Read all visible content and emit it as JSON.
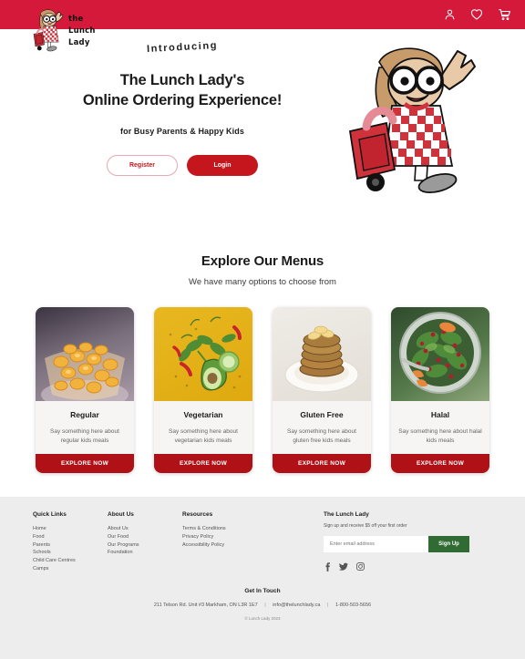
{
  "header": {
    "logo": {
      "mark": "lunch-lady-mascot-logo",
      "line1": "the",
      "line2": "Lunch",
      "line3": "Lady"
    },
    "icons": [
      {
        "name": "account-icon",
        "label": "Account"
      },
      {
        "name": "wishlist-heart-icon",
        "label": "Wishlist"
      },
      {
        "name": "shopping-cart-icon",
        "label": "Cart"
      }
    ],
    "background_color": "#D4193A"
  },
  "hero": {
    "eyebrow": "Introducing",
    "title_line1": "The Lunch Lady's",
    "title_line2": "Online Ordering Experience!",
    "subtitle": "for Busy Parents & Happy Kids",
    "register_label": "Register",
    "login_label": "Login",
    "register_color": "#C4161C",
    "login_bg": "#C4161C",
    "illustration": "lunch-lady-waving-with-cooler-bag"
  },
  "menus": {
    "title": "Explore Our Menus",
    "subtitle": "We have many options to choose from",
    "cards": [
      {
        "title": "Regular",
        "description": "Say something here about regular kids meals",
        "button": "EXPLORE NOW",
        "image": "macaroni-and-cheese-bowl"
      },
      {
        "title": "Vegetarian",
        "description": "Say something here about vegetarian kids meals",
        "button": "EXPLORE NOW",
        "image": "avocado-vegetables-yellow-background"
      },
      {
        "title": "Gluten Free",
        "description": "Say something here about gluten free kids meals",
        "button": "EXPLORE NOW",
        "image": "stack-of-pancakes-with-banana"
      },
      {
        "title": "Halal",
        "description": "Say something here about halal kids meals",
        "button": "EXPLORE NOW",
        "image": "green-salad-with-pomegranate"
      }
    ],
    "button_color": "#B01116"
  },
  "footer": {
    "quick_links": {
      "heading": "Quick Links",
      "items": [
        "Home",
        "Food",
        "Parents",
        "Schools",
        "Child Care Centres",
        "Camps"
      ]
    },
    "about_us": {
      "heading": "About Us",
      "items": [
        "About Us",
        "Our Food",
        "Our Programs",
        "Foundation"
      ]
    },
    "resources": {
      "heading": "Resources",
      "items": [
        "Terms & Conditions",
        "Privacy Policy",
        "Accessibility Policy"
      ]
    },
    "newsletter": {
      "heading": "The Lunch Lady",
      "subtext": "Sign up and receive $5 off your first order",
      "placeholder": "Enter email address",
      "value": "",
      "button": "Sign Up",
      "button_color": "#2F6B32"
    },
    "socials": [
      {
        "name": "facebook-icon",
        "label": "Facebook"
      },
      {
        "name": "twitter-icon",
        "label": "Twitter"
      },
      {
        "name": "instagram-icon",
        "label": "Instagram"
      }
    ],
    "contact": {
      "heading": "Get In Touch",
      "address": "211 Telson Rd. Unit #3 Markham, ON L3R 1E7",
      "email": "info@thelunchlady.ca",
      "phone": "1-800-503-5656",
      "separator": "|"
    },
    "copyright": "© Lunch Lady 2023",
    "background_color": "#EDEDED"
  }
}
